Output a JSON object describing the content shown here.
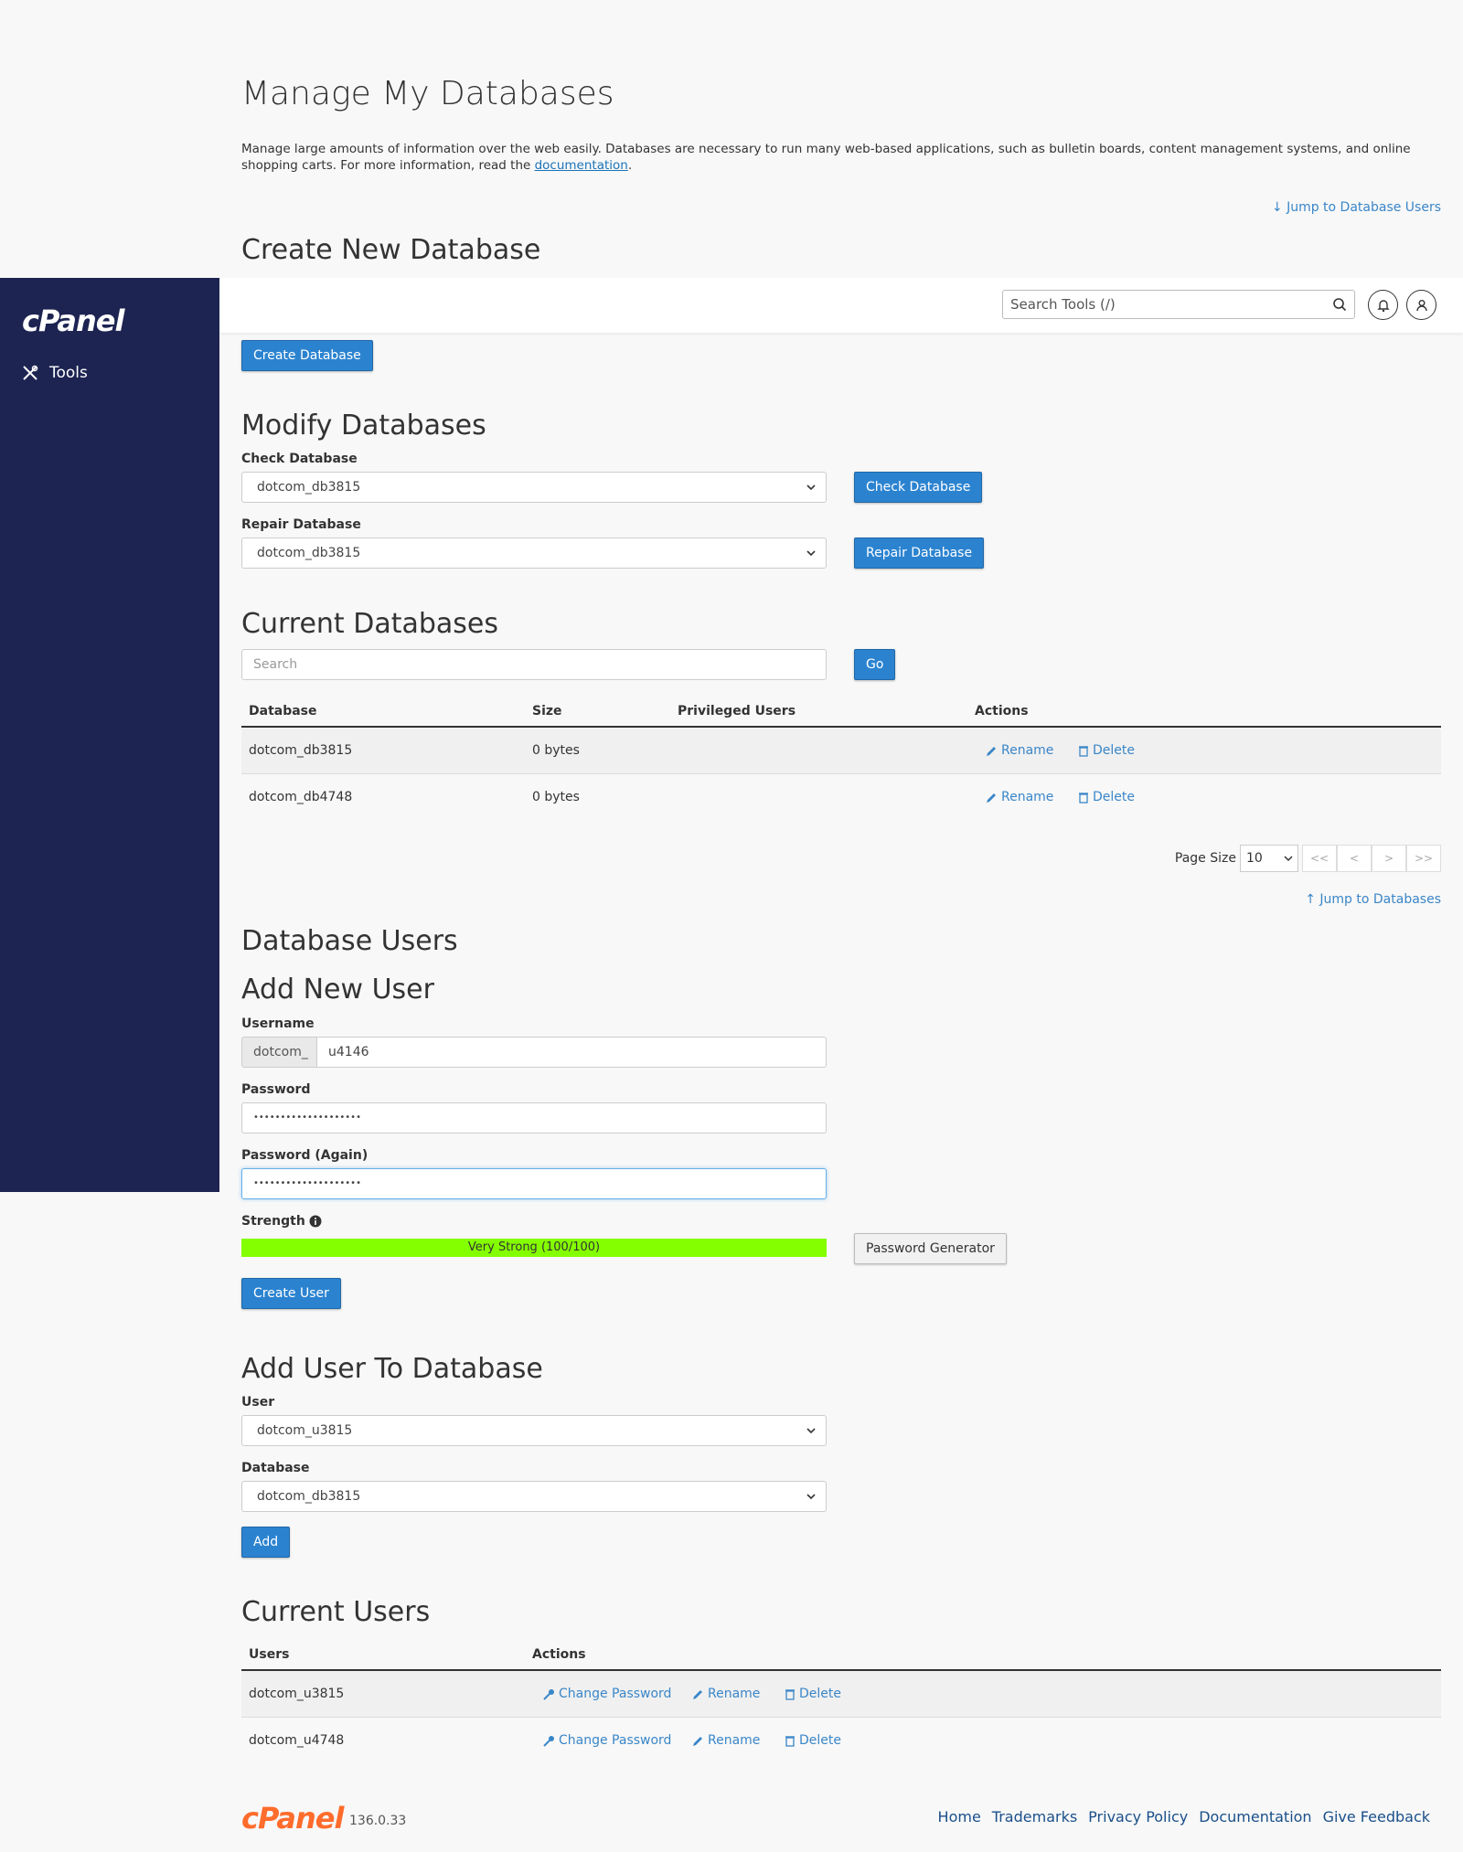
{
  "sidebar": {
    "logo": "cPanel",
    "tools_label": "Tools"
  },
  "topbar": {
    "search_placeholder": "Search Tools (/)"
  },
  "page": {
    "title": "Manage My Databases",
    "description": "Manage large amounts of information over the web easily. Databases are necessary to run many web-based applications, such as bulletin boards, content management systems, and online shopping carts. For more information, read the ",
    "doc_link": "documentation",
    "desc_end": ".",
    "jump_users": "Jump to Database Users",
    "jump_databases": "Jump to Databases"
  },
  "create_db": {
    "heading": "Create New Database",
    "button": "Create Database"
  },
  "modify": {
    "heading": "Modify Databases",
    "check_label": "Check Database",
    "check_value": "dotcom_db3815",
    "check_button": "Check Database",
    "repair_label": "Repair Database",
    "repair_value": "dotcom_db3815",
    "repair_button": "Repair Database"
  },
  "current_dbs": {
    "heading": "Current Databases",
    "search_placeholder": "Search",
    "go": "Go",
    "columns": [
      "Database",
      "Size",
      "Privileged Users",
      "Actions"
    ],
    "rows": [
      {
        "name": "dotcom_db3815",
        "size": "0 bytes",
        "users": "",
        "rename": "Rename",
        "delete": "Delete"
      },
      {
        "name": "dotcom_db4748",
        "size": "0 bytes",
        "users": "",
        "rename": "Rename",
        "delete": "Delete"
      }
    ],
    "page_size_label": "Page Size",
    "page_size": "10",
    "pager": [
      "<<",
      "<",
      ">",
      ">>"
    ]
  },
  "db_users": {
    "heading": "Database Users",
    "add_heading": "Add New User",
    "username_label": "Username",
    "prefix": "dotcom_",
    "username_value": "u4146",
    "password_label": "Password",
    "password_value": "••••••••••••••••••••",
    "password_again_label": "Password (Again)",
    "password_again_value": "••••••••••••••••••••",
    "strength_label": "Strength",
    "strength_text": "Very Strong (100/100)",
    "strength_value": 100,
    "generator_button": "Password Generator",
    "create_button": "Create User"
  },
  "add_to_db": {
    "heading": "Add User To Database",
    "user_label": "User",
    "user_value": "dotcom_u3815",
    "db_label": "Database",
    "db_value": "dotcom_db3815",
    "add_button": "Add"
  },
  "current_users": {
    "heading": "Current Users",
    "columns": [
      "Users",
      "Actions"
    ],
    "rows": [
      {
        "name": "dotcom_u3815",
        "change": "Change Password",
        "rename": "Rename",
        "delete": "Delete"
      },
      {
        "name": "dotcom_u4748",
        "change": "Change Password",
        "rename": "Rename",
        "delete": "Delete"
      }
    ]
  },
  "footer": {
    "logo": "cPanel",
    "version": "136.0.33",
    "links": [
      "Home",
      "Trademarks",
      "Privacy Policy",
      "Documentation",
      "Give Feedback"
    ]
  },
  "colors": {
    "sidebar": "#1d2452",
    "primary": "#2b83d0",
    "link": "#3a86c8",
    "strength": "#84ff00",
    "brand_orange": "#ff6c2c"
  }
}
